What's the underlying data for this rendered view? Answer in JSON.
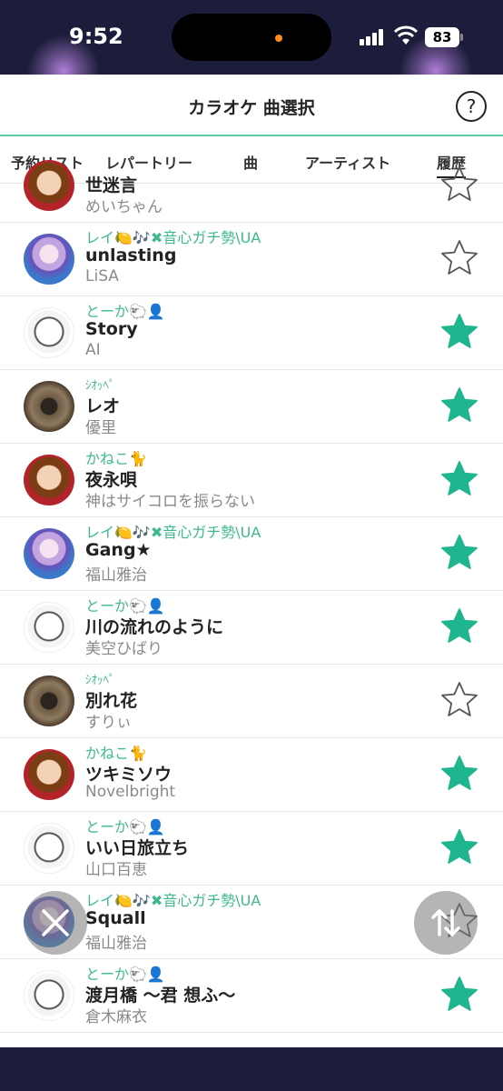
{
  "status_bar": {
    "time": "9:52",
    "battery": "83"
  },
  "header": {
    "title": "カラオケ 曲選択",
    "help_label": "?"
  },
  "tabs": [
    {
      "label": "予約リスト",
      "active": false
    },
    {
      "label": "レパートリー",
      "active": false
    },
    {
      "label": "曲",
      "active": false
    },
    {
      "label": "アーティスト",
      "active": false
    },
    {
      "label": "履歴",
      "active": true
    }
  ],
  "songs": [
    {
      "user": "",
      "title": "世迷言",
      "artist": "めいちゃん",
      "favorite": false,
      "avatar": "av-red"
    },
    {
      "user": "レイ🍋🎶✖音心ガチ勢\\UA",
      "title": "unlasting",
      "artist": "LiSA",
      "favorite": false,
      "avatar": "av-anime"
    },
    {
      "user": "とーか🐑👤",
      "title": "Story",
      "artist": "AI",
      "favorite": true,
      "avatar": "av-cat"
    },
    {
      "user": "ｼｵｯﾍﾟ",
      "title": "レオ",
      "artist": "優里",
      "favorite": true,
      "avatar": "av-photo"
    },
    {
      "user": "かねこ🐈",
      "title": "夜永唄",
      "artist": "神はサイコロを振らない",
      "favorite": true,
      "avatar": "av-red"
    },
    {
      "user": "レイ🍋🎶✖音心ガチ勢\\UA",
      "title": "Gang★",
      "artist": "福山雅治",
      "favorite": true,
      "avatar": "av-anime"
    },
    {
      "user": "とーか🐑👤",
      "title": "川の流れのように",
      "artist": "美空ひばり",
      "favorite": true,
      "avatar": "av-cat"
    },
    {
      "user": "ｼｵｯﾍﾟ",
      "title": "別れ花",
      "artist": "すりぃ",
      "favorite": false,
      "avatar": "av-photo"
    },
    {
      "user": "かねこ🐈",
      "title": "ツキミソウ",
      "artist": "Novelbright",
      "favorite": true,
      "avatar": "av-red"
    },
    {
      "user": "とーか🐑👤",
      "title": "いい日旅立ち",
      "artist": "山口百恵",
      "favorite": true,
      "avatar": "av-cat"
    },
    {
      "user": "レイ🍋🎶✖音心ガチ勢\\UA",
      "title": "Squall",
      "artist": "福山雅治",
      "favorite": false,
      "avatar": "av-anime"
    },
    {
      "user": "とーか🐑👤",
      "title": "渡月橋 〜君 想ふ〜",
      "artist": "倉木麻衣",
      "favorite": true,
      "avatar": "av-cat"
    }
  ],
  "colors": {
    "accent": "#3fb890",
    "star_filled": "#1fb58f"
  }
}
